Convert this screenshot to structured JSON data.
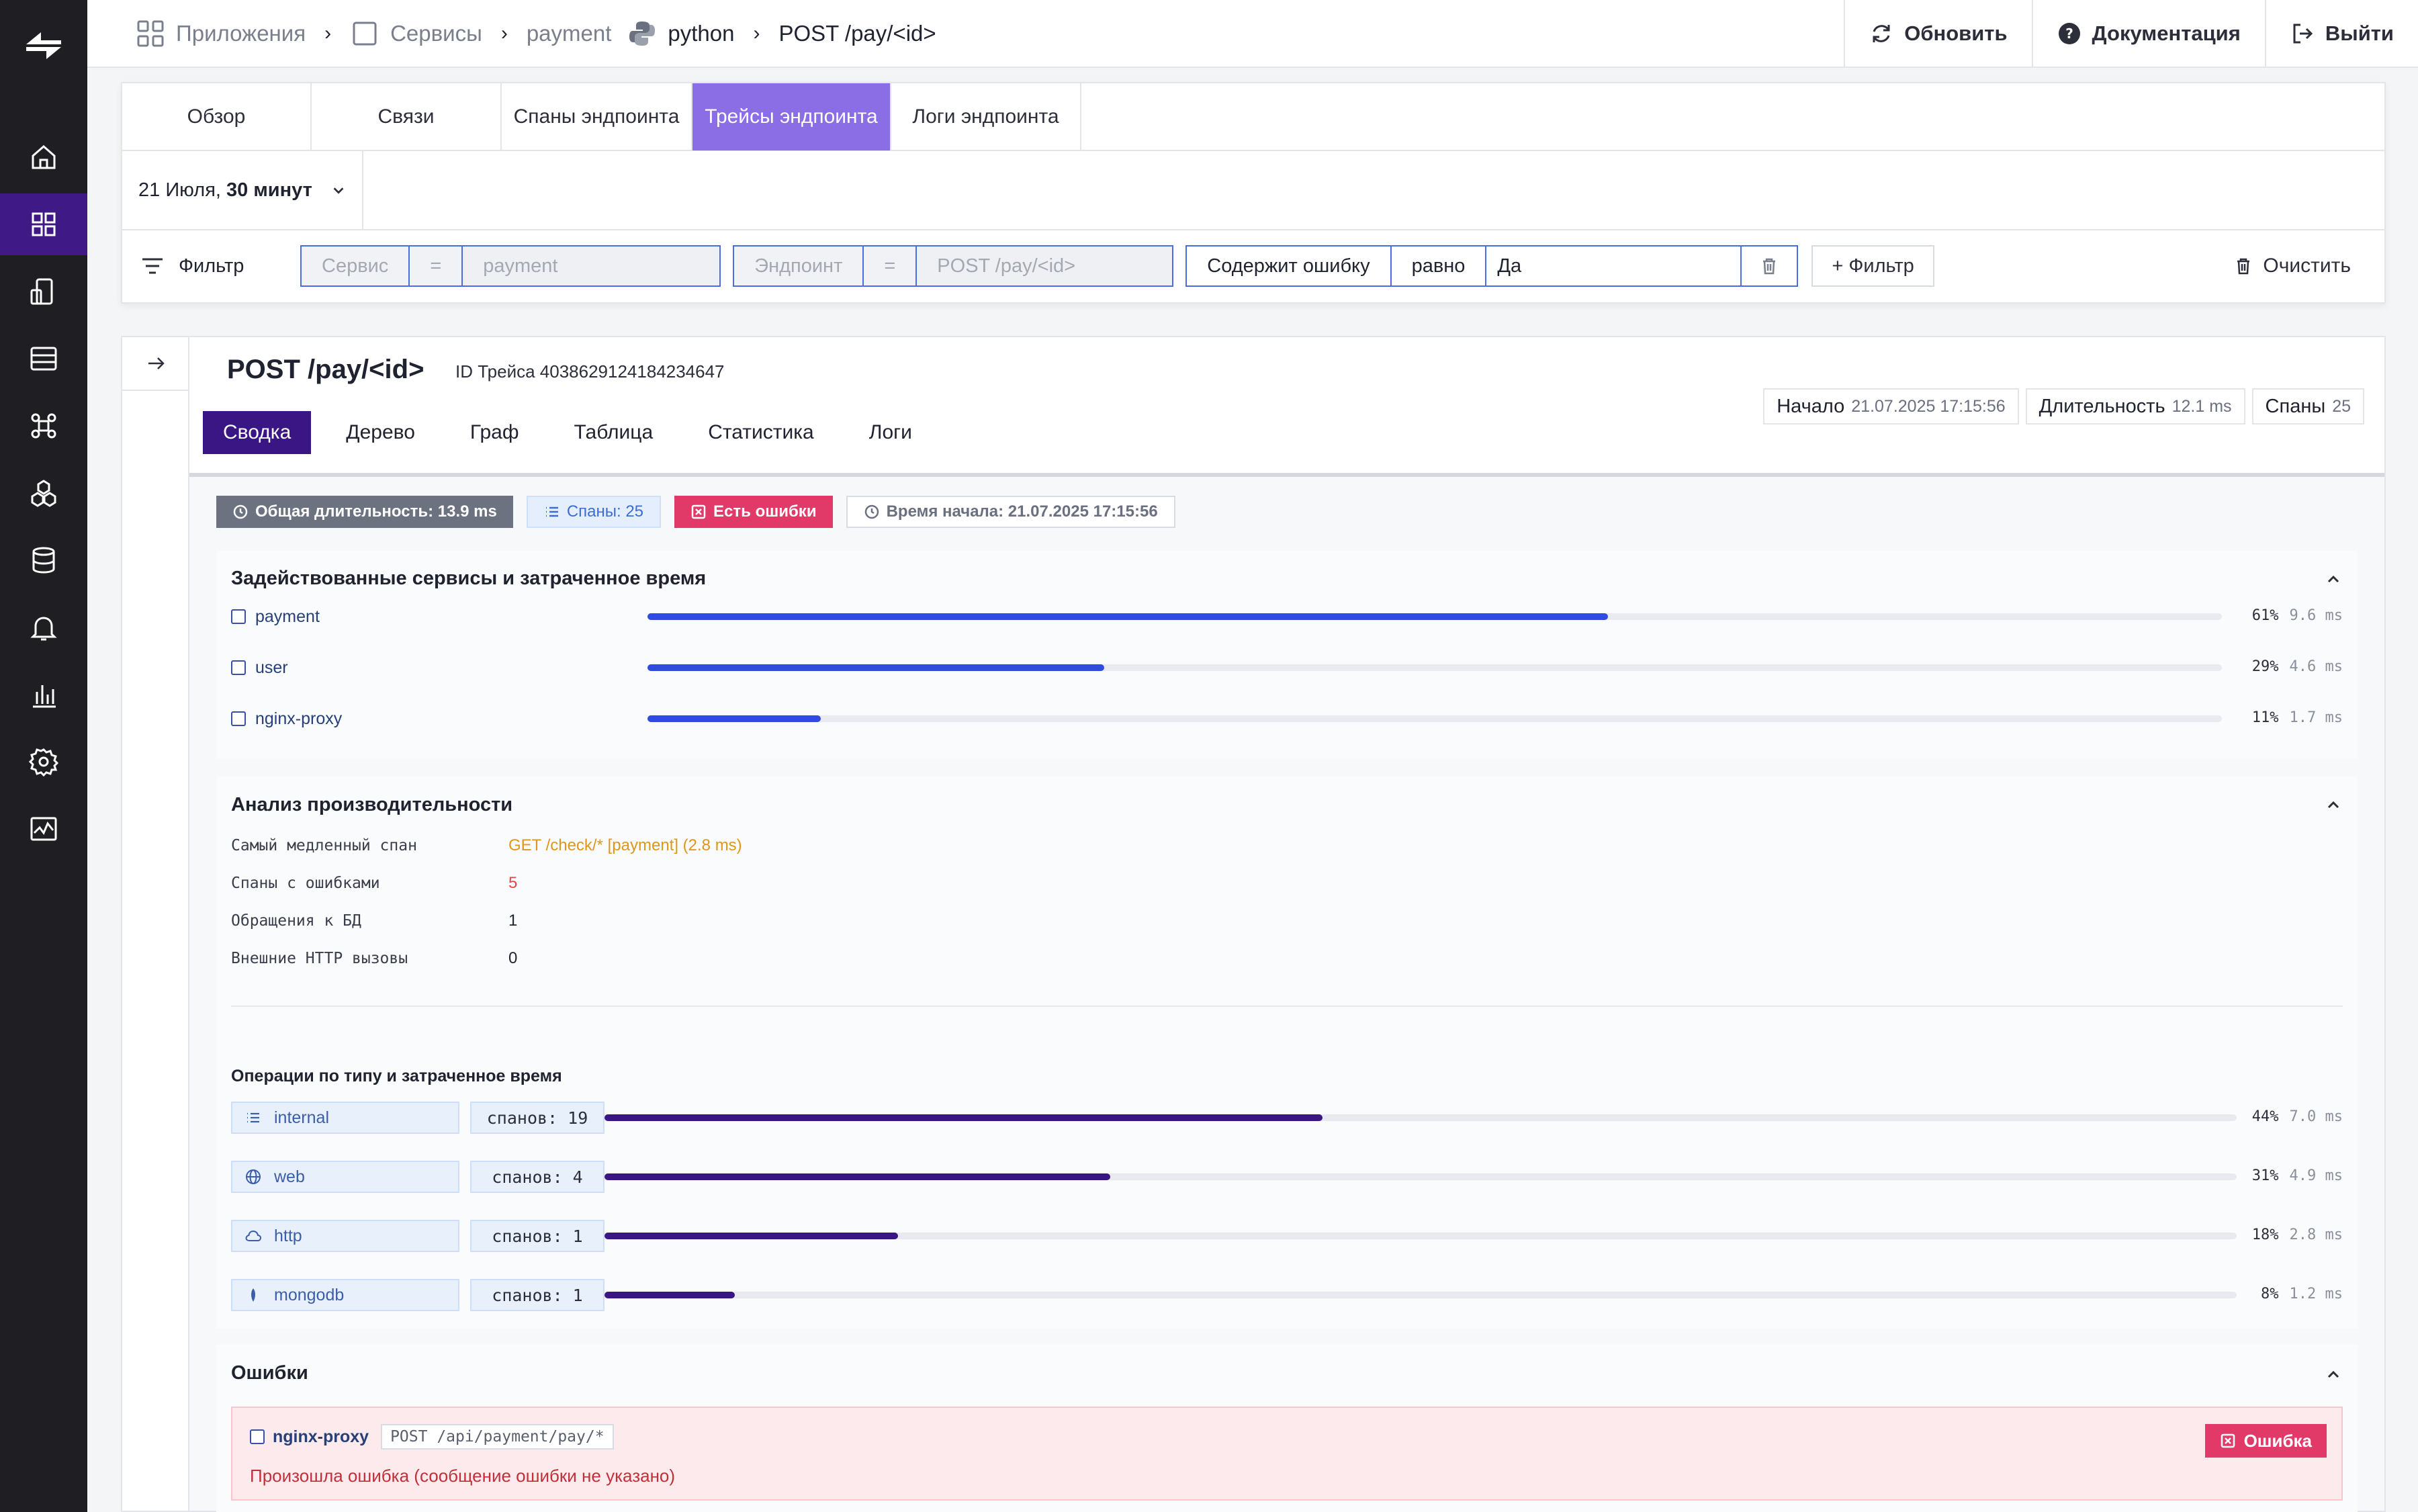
{
  "breadcrumbs": {
    "apps": "Приложения",
    "services": "Сервисы",
    "service": "payment",
    "lang": "python",
    "endpoint": "POST /pay/<id>"
  },
  "top_actions": {
    "refresh": "Обновить",
    "docs": "Документация",
    "logout": "Выйти"
  },
  "tabs": [
    "Обзор",
    "Связи",
    "Спаны эндпоинта",
    "Трейсы эндпоинта",
    "Логи эндпоинта"
  ],
  "active_tab": "Трейсы эндпоинта",
  "date": {
    "day": "21 Июля,",
    "range": "30 минут"
  },
  "filter": {
    "label": "Фильтр",
    "service": {
      "field": "Сервис",
      "op": "=",
      "value": "payment"
    },
    "endpoint": {
      "field": "Эндпоинт",
      "op": "=",
      "value": "POST /pay/<id>"
    },
    "error": {
      "field": "Содержит ошибку",
      "op": "равно",
      "value": "Да"
    },
    "add": "+ Фильтр",
    "clear": "Очистить"
  },
  "trace": {
    "title": "POST /pay/<id>",
    "id_label": "ID Трейса 4038629124184234647",
    "subtabs": [
      "Сводка",
      "Дерево",
      "Граф",
      "Таблица",
      "Статистика",
      "Логи"
    ],
    "meta": {
      "start_k": "Начало",
      "start_v": "21.07.2025 17:15:56",
      "dur_k": "Длительность",
      "dur_v": "12.1 ms",
      "spans_k": "Спаны",
      "spans_v": "25"
    },
    "badges": {
      "total": "Общая длительность: 13.9 ms",
      "spans": "Спаны: 25",
      "errors": "Есть ошибки",
      "start": "Время начала: 21.07.2025 17:15:56"
    }
  },
  "services_section": {
    "title": "Задействованные сервисы и затраченное время",
    "rows": [
      {
        "name": "payment",
        "fraction": 0.61,
        "pct": "61%",
        "ms": "9.6 ms"
      },
      {
        "name": "user",
        "fraction": 0.29,
        "pct": "29%",
        "ms": "4.6 ms"
      },
      {
        "name": "nginx-proxy",
        "fraction": 0.11,
        "pct": "11%",
        "ms": "1.7 ms"
      }
    ]
  },
  "perf_section": {
    "title": "Анализ производительности",
    "slowest_k": "Самый медленный спан",
    "slowest_v": "GET /check/* [payment] (2.8 ms)",
    "errors_k": "Спаны с ошибками",
    "errors_v": "5",
    "db_k": "Обращения к БД",
    "db_v": "1",
    "http_k": "Внешние HTTP вызовы",
    "http_v": "0",
    "ops_title": "Операции по типу и затраченное время",
    "ops": [
      {
        "type": "internal",
        "icon": "list-icon",
        "count": "спанов: 19",
        "fraction": 0.44,
        "pct": "44%",
        "ms": "7.0 ms"
      },
      {
        "type": "web",
        "icon": "globe-icon",
        "count": "спанов: 4",
        "fraction": 0.31,
        "pct": "31%",
        "ms": "4.9 ms"
      },
      {
        "type": "http",
        "icon": "cloud-icon",
        "count": "спанов: 1",
        "fraction": 0.18,
        "pct": "18%",
        "ms": "2.8 ms"
      },
      {
        "type": "mongodb",
        "icon": "leaf-icon",
        "count": "спанов: 1",
        "fraction": 0.08,
        "pct": "8%",
        "ms": "1.2 ms"
      }
    ]
  },
  "errors_section": {
    "title": "Ошибки",
    "items": [
      {
        "service": "nginx-proxy",
        "path": "POST /api/payment/pay/*",
        "message": "Произошла ошибка (сообщение ошибки не указано)",
        "button": "Ошибка"
      }
    ]
  },
  "colors": {
    "accent": "#3a1685",
    "tab_active": "#8b6ee6",
    "service_bar": "#2f4be0",
    "ops_bar": "#3a1685",
    "error": "#e23a68",
    "slowest": "#e0961a"
  }
}
